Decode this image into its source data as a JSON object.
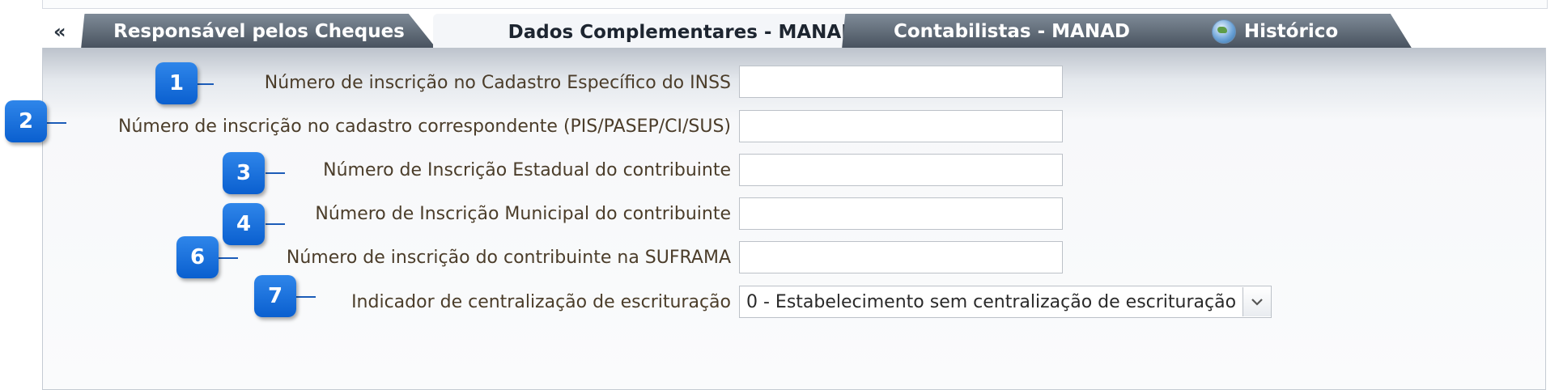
{
  "collapse_glyph": "«",
  "tabs": [
    {
      "label": "Responsável pelos Cheques",
      "active": false
    },
    {
      "label": "Dados Complementares - MANAD",
      "active": true
    },
    {
      "label": "Contabilistas - MANAD",
      "active": false
    },
    {
      "label": "Histórico",
      "active": false,
      "icon": "globe-icon"
    }
  ],
  "form": {
    "fields": [
      {
        "label": "Número de inscrição no Cadastro Específico do INSS",
        "value": ""
      },
      {
        "label": "Número de inscrição no cadastro correspondente (PIS/PASEP/CI/SUS)",
        "value": ""
      },
      {
        "label": "Número de Inscrição Estadual do contribuinte",
        "value": ""
      },
      {
        "label": "Número de Inscrição Municipal do contribuinte",
        "value": ""
      },
      {
        "label": "Número de inscrição do contribuinte na SUFRAMA",
        "value": ""
      }
    ],
    "select": {
      "label": "Indicador de centralização de escrituração",
      "value": "0 - Estabelecimento sem centralização de escrituração"
    }
  },
  "callouts": [
    "1",
    "2",
    "3",
    "4",
    "6",
    "7"
  ],
  "colors": {
    "badge": "#0a5fcf",
    "label_text": "#4b3d2a",
    "tab_inactive": "#46505c"
  }
}
